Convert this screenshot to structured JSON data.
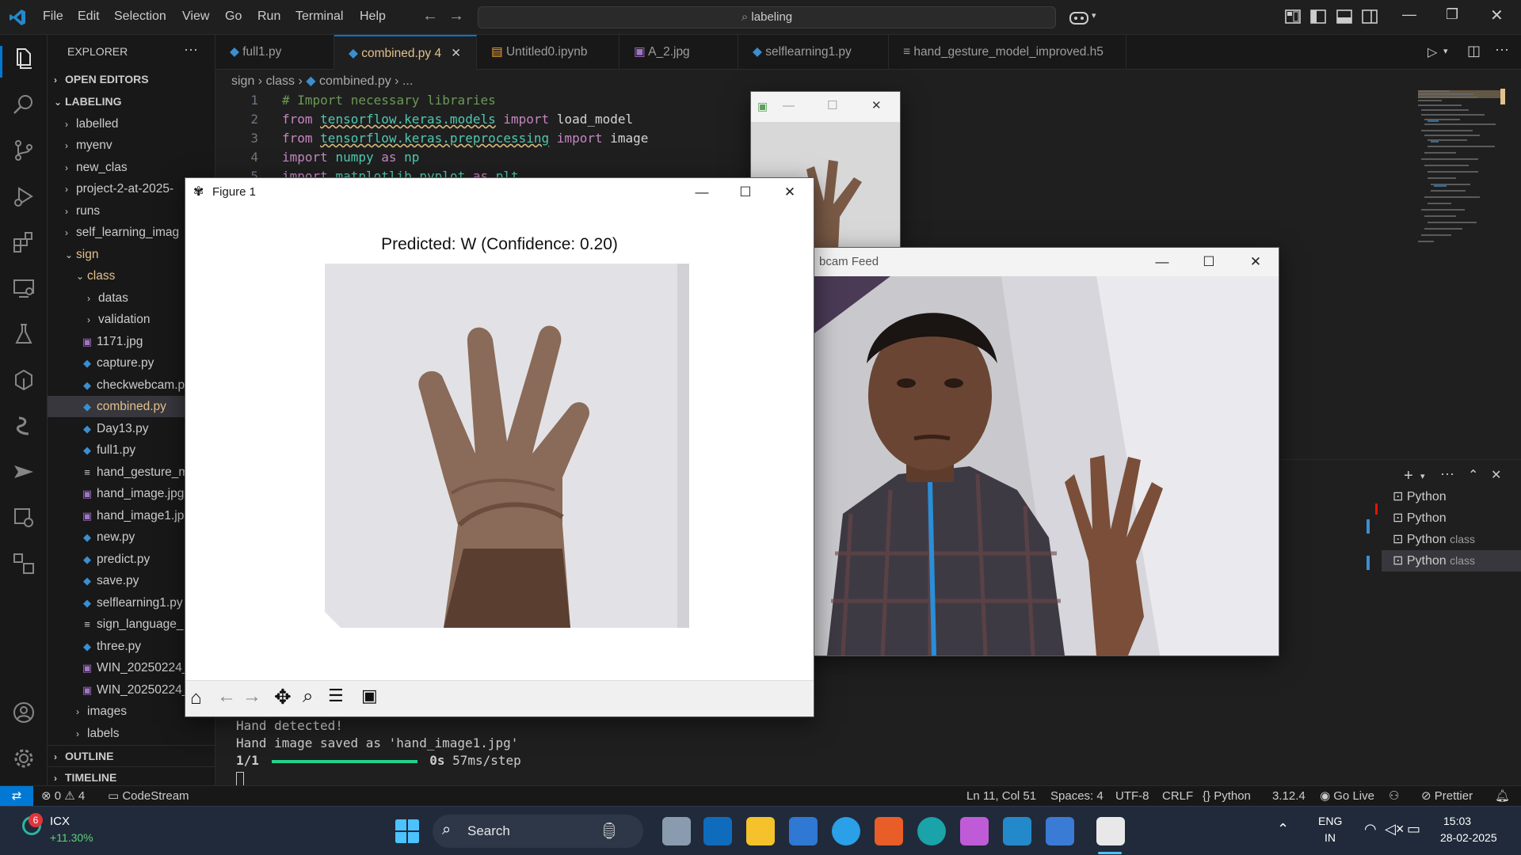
{
  "menu": [
    "File",
    "Edit",
    "Selection",
    "View",
    "Go",
    "Run",
    "Terminal",
    "Help"
  ],
  "search": "labeling",
  "sidebar": {
    "title": "EXPLORER",
    "open_editors": "OPEN EDITORS",
    "workspace": "LABELING",
    "items": [
      "labelled",
      "myenv",
      "new_clas",
      "project-2-at-2025-",
      "runs",
      "self_learning_imag",
      "sign",
      "class",
      "datas",
      "validation",
      "1171.jpg",
      "capture.py",
      "checkwebcam.p",
      "combined.py",
      "Day13.py",
      "full1.py",
      "hand_gesture_m",
      "hand_image.jpg",
      "hand_image1.jp",
      "new.py",
      "predict.py",
      "save.py",
      "selflearning1.py",
      "sign_language_",
      "three.py",
      "WIN_20250224_",
      "WIN_20250224_",
      "images",
      "labels"
    ],
    "outline": "OUTLINE",
    "timeline": "TIMELINE"
  },
  "tabs": [
    {
      "label": "full1.py"
    },
    {
      "label": "combined.py",
      "badge": "4"
    },
    {
      "label": "Untitled0.ipynb"
    },
    {
      "label": "A_2.jpg"
    },
    {
      "label": "selflearning1.py"
    },
    {
      "label": "hand_gesture_model_improved.h5"
    }
  ],
  "breadcrumb": [
    "sign",
    "class",
    "combined.py",
    "..."
  ],
  "code": {
    "numbers": [
      "1",
      "2",
      "3",
      "4",
      "5"
    ],
    "l1": "# Import necessary libraries",
    "kw_from": "from",
    "kw_import": "import",
    "kw_as": "as",
    "l2_mod": "tensorflow.keras.models",
    "l2_name": "load_model",
    "l3_mod": "tensorflow.keras.preprocessing",
    "l3_name": "image",
    "l4_mod": "numpy",
    "l4_alias": "np",
    "l5_mod": "matplotlib.pyplot",
    "l5_alias": "plt"
  },
  "terminal": {
    "line1": "Hand detected!",
    "line2": "Hand image saved as 'hand_image1.jpg'",
    "progress_label": "1/1",
    "progress_time": "0s",
    "progress_rate": "57ms/step",
    "progress": 1.0,
    "instances": [
      {
        "label": "Python",
        "sub": ""
      },
      {
        "label": "Python",
        "sub": ""
      },
      {
        "label": "Python",
        "sub": "class"
      },
      {
        "label": "Python",
        "sub": "class"
      }
    ]
  },
  "figure": {
    "title": "Figure 1",
    "plot_title": "Predicted: W (Confidence: 0.20)"
  },
  "webcam": {
    "title": "Webcam Feed",
    "visible_title": "bcam Feed"
  },
  "statusbar": {
    "errors": "0",
    "warnings": "4",
    "codestream": "CodeStream",
    "position": "Ln 11, Col 51",
    "spaces": "Spaces: 4",
    "encoding": "UTF-8",
    "eol": "CRLF",
    "language": "Python",
    "version": "3.12.4",
    "golive": "Go Live",
    "prettier": "Prettier"
  },
  "taskbar": {
    "stock_badge": "6",
    "stock_name": "ICX",
    "stock_change": "+11.30%",
    "search": "Search",
    "lang1": "ENG",
    "lang2": "IN",
    "time": "15:03",
    "date": "28-02-2025"
  },
  "colors": {
    "accent": "#0078d4",
    "active_tab_text": "#e2c08d",
    "progress": "#23d18b"
  }
}
